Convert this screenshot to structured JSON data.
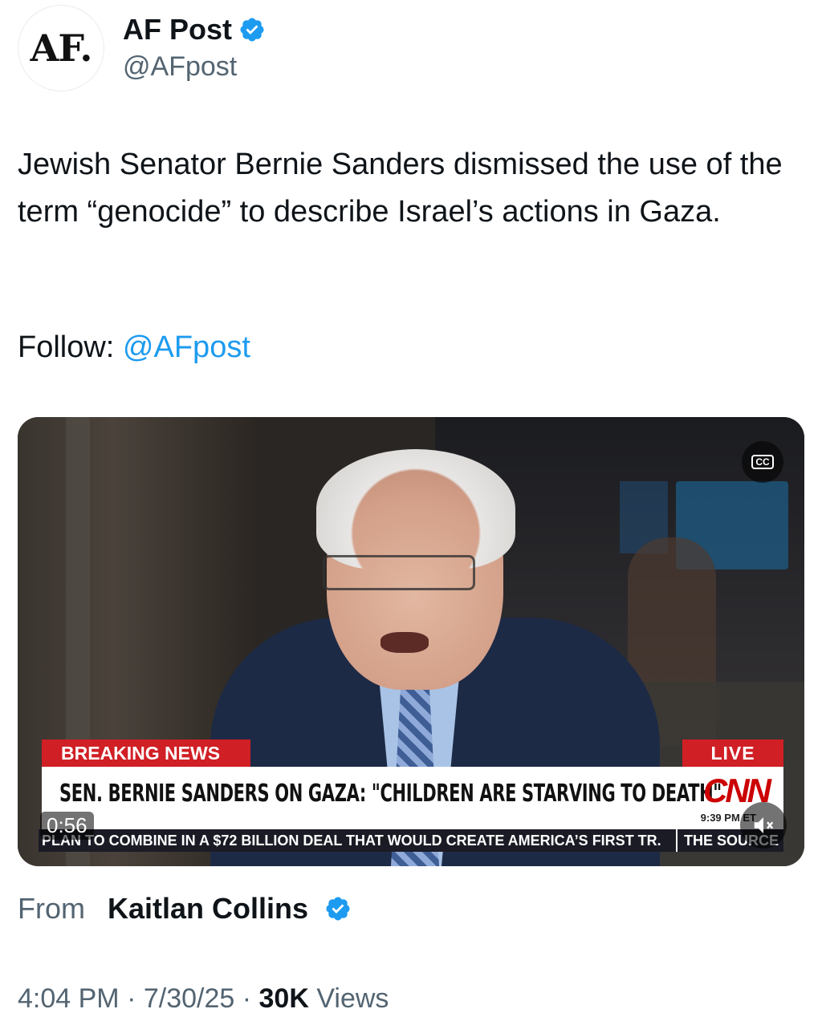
{
  "author": {
    "avatar_text": "AF.",
    "display_name": "AF Post",
    "handle": "@AFpost",
    "verified": true
  },
  "tweet": {
    "text": "Jewish Senator Bernie Sanders dismissed the use of the term “genocide” to describe Israel’s actions in Gaza.",
    "follow_label": "Follow: ",
    "follow_handle": "@AFpost"
  },
  "video": {
    "cc_label": "CC",
    "breaking_label": "BREAKING NEWS",
    "live_label": "LIVE",
    "headline": "SEN. BERNIE SANDERS ON GAZA: \"CHILDREN ARE STARVING TO DEATH\"",
    "network_logo": "CNN",
    "network_time": "9:39 PM ET",
    "ticker_text": "PLAN TO COMBINE IN A $72 BILLION DEAL THAT WOULD CREATE AMERICA’S FIRST TR.",
    "ticker_show": "THE SOURCE",
    "duration": "0:56",
    "mute_icon": "speaker-muted-icon"
  },
  "source": {
    "from_label": "From",
    "name": "Kaitlan Collins",
    "verified": true
  },
  "meta": {
    "time": "4:04 PM",
    "sep1": " · ",
    "date": "7/30/25",
    "sep2": " · ",
    "views_count": "30K",
    "views_label": " Views"
  },
  "colors": {
    "link": "#1d9bf0",
    "verified": "#1d9bf0",
    "secondary_text": "#536471",
    "cnn_red": "#d01f25"
  }
}
